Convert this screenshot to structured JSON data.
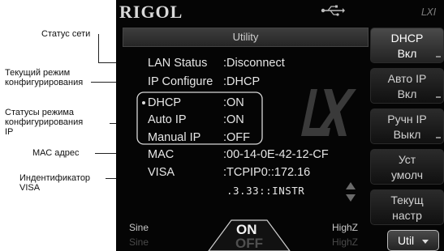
{
  "annotations": {
    "network_status": "Статус сети",
    "current_mode_line1": "Текущий режим",
    "current_mode_line2": "конфигурирования",
    "mode_status_line1": "Статусы режима",
    "mode_status_line2": "конфигурирования",
    "mode_status_line3": "IP",
    "mac_address": "МАС адрес",
    "visa_id_line1": "Индентификатор",
    "visa_id_line2": "VISA"
  },
  "device": {
    "brand": "RIGOL",
    "top_right_logo": "LXI",
    "usb_icon": "usb-icon",
    "title": "Utility"
  },
  "status": {
    "lan_status_label": "LAN Status",
    "lan_status_value": ":Disconnect",
    "ip_configure_label": "IP Configure",
    "ip_configure_value": ":DHCP",
    "dhcp_label": "DHCP",
    "dhcp_value": ":ON",
    "auto_ip_label": "Auto IP",
    "auto_ip_value": ":ON",
    "manual_ip_label": "Manual IP",
    "manual_ip_value": ":OFF",
    "mac_label": "MAC",
    "mac_value": ":00-14-0E-42-12-CF",
    "visa_label": "VISA",
    "visa_value_line1": ":TCPIP0::172.16",
    "visa_value_line2": ".3.33::INSTR"
  },
  "softkeys": [
    {
      "line1": "DHCP",
      "line2": "Вкл"
    },
    {
      "line1": "Авто IP",
      "line2": "Вкл"
    },
    {
      "line1": "Ручн IP",
      "line2": "Выкл"
    },
    {
      "line1": "Уст",
      "line2": "умолч"
    },
    {
      "line1": "Текущ",
      "line2": "настр"
    },
    {
      "line1": "Util",
      "line2": ""
    }
  ],
  "bottom": {
    "left_top": "Sine",
    "left_bottom": "Sine",
    "on_label": "ON",
    "off_label": "OFF",
    "right_top": "HighZ",
    "right_bottom": "HighZ"
  },
  "colors": {
    "screen_bg": "#050505",
    "text": "#e6e6e6",
    "dim_text": "#555555"
  }
}
